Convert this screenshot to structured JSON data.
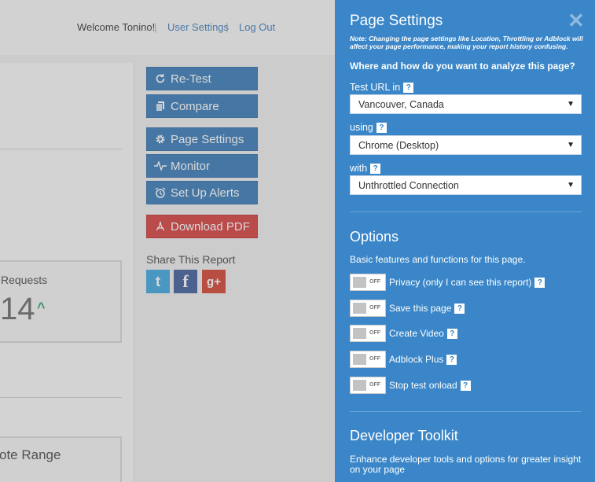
{
  "header": {
    "welcome": "Welcome Tonino!",
    "separator": "|",
    "user_settings": "User Settings",
    "log_out": "Log Out"
  },
  "report": {
    "requests_label": "Requests",
    "requests_value": "14",
    "range_label": "ote Range"
  },
  "actions": {
    "retest": "Re-Test",
    "compare": "Compare",
    "page_settings": "Page Settings",
    "monitor": "Monitor",
    "alerts": "Set Up Alerts",
    "pdf": "Download PDF"
  },
  "share": {
    "title": "Share This Report",
    "twitter_glyph": "t",
    "facebook_glyph": "f",
    "google_glyph": "g+"
  },
  "panel": {
    "title": "Page Settings",
    "close": "✕",
    "note": "Note: Changing the page settings like Location, Throttling or Adblock will affect your page performance, making your report history confusing.",
    "question": "Where and how do you want to analyze this page?",
    "help": "?",
    "test_url_label": "Test URL in",
    "location": "Vancouver, Canada",
    "using_label": "using",
    "browser": "Chrome (Desktop)",
    "with_label": "with",
    "connection": "Unthrottled Connection",
    "caret": "▼"
  },
  "options": {
    "title": "Options",
    "subtitle": "Basic features and functions for this page.",
    "off_text": "OFF",
    "items": [
      {
        "label": "Privacy (only I can see this report)",
        "state": "off"
      },
      {
        "label": "Save this page",
        "state": "off"
      },
      {
        "label": "Create Video",
        "state": "off"
      },
      {
        "label": "Adblock Plus",
        "state": "off"
      },
      {
        "label": "Stop test onload",
        "state": "off"
      }
    ]
  },
  "developer": {
    "title": "Developer Toolkit",
    "subtitle": "Enhance developer tools and options for greater insight on your page"
  },
  "colors": {
    "panel_bg": "#3a86c8",
    "button_blue": "#3478b6",
    "button_red": "#d33b3b"
  }
}
